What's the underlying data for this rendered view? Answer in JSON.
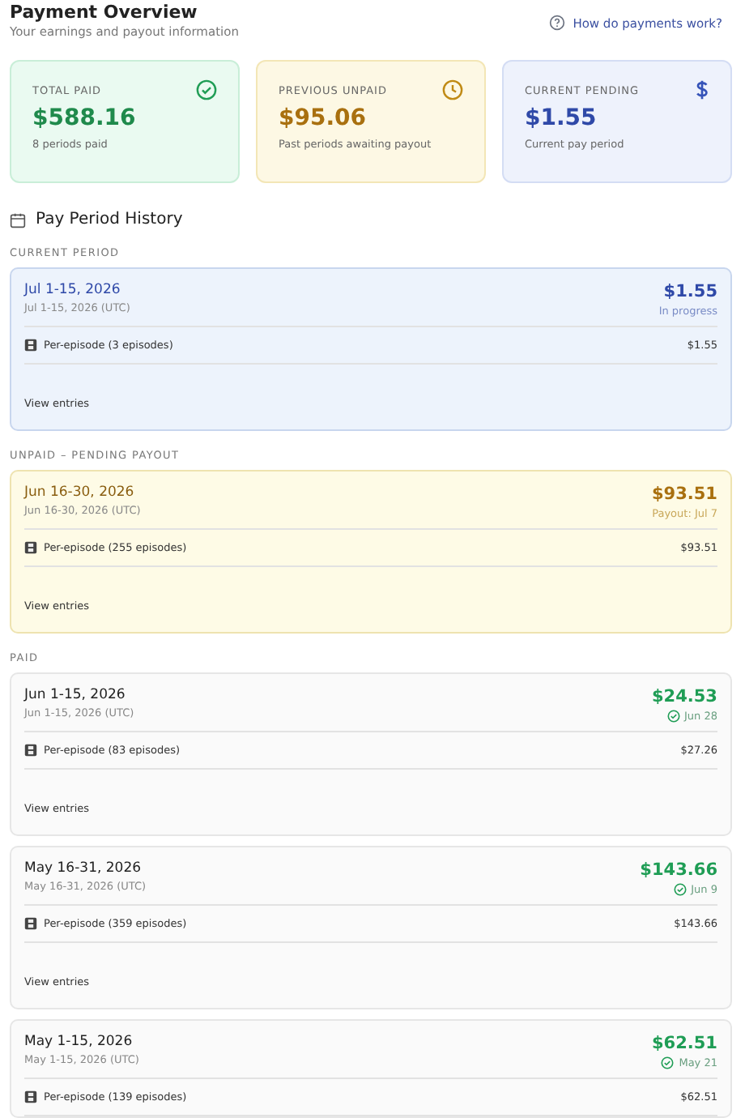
{
  "header": {
    "title": "Payment Overview",
    "subtitle": "Your earnings and payout information",
    "help_link": "How do payments work?"
  },
  "stats": [
    {
      "kind": "paid",
      "label": "TOTAL PAID",
      "amount": "$588.16",
      "note": "8 periods paid"
    },
    {
      "kind": "unpaid",
      "label": "PREVIOUS UNPAID",
      "amount": "$95.06",
      "note": "Past periods awaiting payout"
    },
    {
      "kind": "pending",
      "label": "CURRENT PENDING",
      "amount": "$1.55",
      "note": "Current pay period"
    }
  ],
  "history_title": "Pay Period History",
  "sections": [
    {
      "label": "CURRENT PERIOD",
      "periods": [
        {
          "kind": "current",
          "title": "Jul 1-15, 2026",
          "range": "Jul 1-15, 2026 (UTC)",
          "amount": "$1.55",
          "status": "In progress",
          "line_item": "Per-episode (3 episodes)",
          "line_amount": "$1.55",
          "link": "View entries"
        }
      ]
    },
    {
      "label": "UNPAID – PENDING PAYOUT",
      "periods": [
        {
          "kind": "unpaid",
          "title": "Jun 16-30, 2026",
          "range": "Jun 16-30, 2026 (UTC)",
          "amount": "$93.51",
          "status": "Payout: Jul 7",
          "line_item": "Per-episode (255 episodes)",
          "line_amount": "$93.51",
          "link": "View entries"
        }
      ]
    },
    {
      "label": "PAID",
      "periods": [
        {
          "kind": "paid",
          "title": "Jun 1-15, 2026",
          "range": "Jun 1-15, 2026 (UTC)",
          "amount": "$24.53",
          "status": "Jun 28",
          "line_item": "Per-episode (83 episodes)",
          "line_amount": "$27.26",
          "link": "View entries"
        },
        {
          "kind": "paid",
          "title": "May 16-31, 2026",
          "range": "May 16-31, 2026 (UTC)",
          "amount": "$143.66",
          "status": "Jun 9",
          "line_item": "Per-episode (359 episodes)",
          "line_amount": "$143.66",
          "link": "View entries"
        },
        {
          "kind": "paid",
          "title": "May 1-15, 2026",
          "range": "May 1-15, 2026 (UTC)",
          "amount": "$62.51",
          "status": "May 21",
          "line_item": "Per-episode (139 episodes)",
          "line_amount": "$62.51"
        }
      ]
    }
  ]
}
